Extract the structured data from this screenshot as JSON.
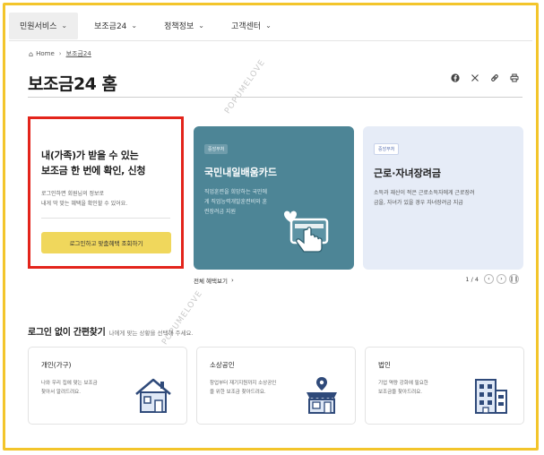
{
  "nav": {
    "items": [
      {
        "label": "민원서비스",
        "active": true
      },
      {
        "label": "보조금24",
        "active": false
      },
      {
        "label": "정책정보",
        "active": false
      },
      {
        "label": "고객센터",
        "active": false
      }
    ]
  },
  "breadcrumb": {
    "home": "Home",
    "current": "보조금24"
  },
  "page": {
    "title": "보조금24 홈"
  },
  "watermark": "POPUMELOVE",
  "login_card": {
    "headline_line1": "내(가족)가 받을 수 있는",
    "headline_line2": "보조금 한 번에 확인, 신청",
    "desc_line1": "로그인하면 회원님의 정보로",
    "desc_line2": "내게 딱 맞는 혜택을 확인할 수 있어요.",
    "cta_label": "로그인하고 맞춤혜택 조회하기"
  },
  "featured": [
    {
      "badge": "중앙부처",
      "title": "국민내일배움카드",
      "desc_line1": "직업훈련을 희망하는 국민에",
      "desc_line2": "게 직업능력개발훈련비와 훈",
      "desc_line3": "련장려금 지원"
    },
    {
      "badge": "중앙부처",
      "title": "근로·자녀장려금",
      "desc_line1": "소득과 재산이 적은 근로소득자에게 근로장려",
      "desc_line2": "금을, 자녀가 있을 경우 자녀장려금 지급"
    }
  ],
  "view_all": "전체 혜택보기",
  "pager": {
    "current": "1",
    "total": "4"
  },
  "quick_find": {
    "title": "로그인 없이 간편찾기",
    "subtitle": "나에게 맞는 상황을 선택해 주세요.",
    "cards": [
      {
        "title": "개인(가구)",
        "desc_line1": "나와 우리 집에 맞는 보조금",
        "desc_line2": "찾아서 알려드려요."
      },
      {
        "title": "소상공인",
        "desc_line1": "창업부터 재기지원까지 소상공인",
        "desc_line2": "을 위한 보조금 찾아드려요."
      },
      {
        "title": "법인",
        "desc_line1": "기업 역량 강화에 필요한",
        "desc_line2": "보조금을 찾아드려요."
      }
    ]
  },
  "colors": {
    "accent_yellow": "#f0d75c",
    "frame": "#f3c52b",
    "highlight_red": "#e3241b",
    "teal_card": "#4d8596",
    "blue_card": "#e6ecf7",
    "icon_navy": "#2f4a7a"
  }
}
